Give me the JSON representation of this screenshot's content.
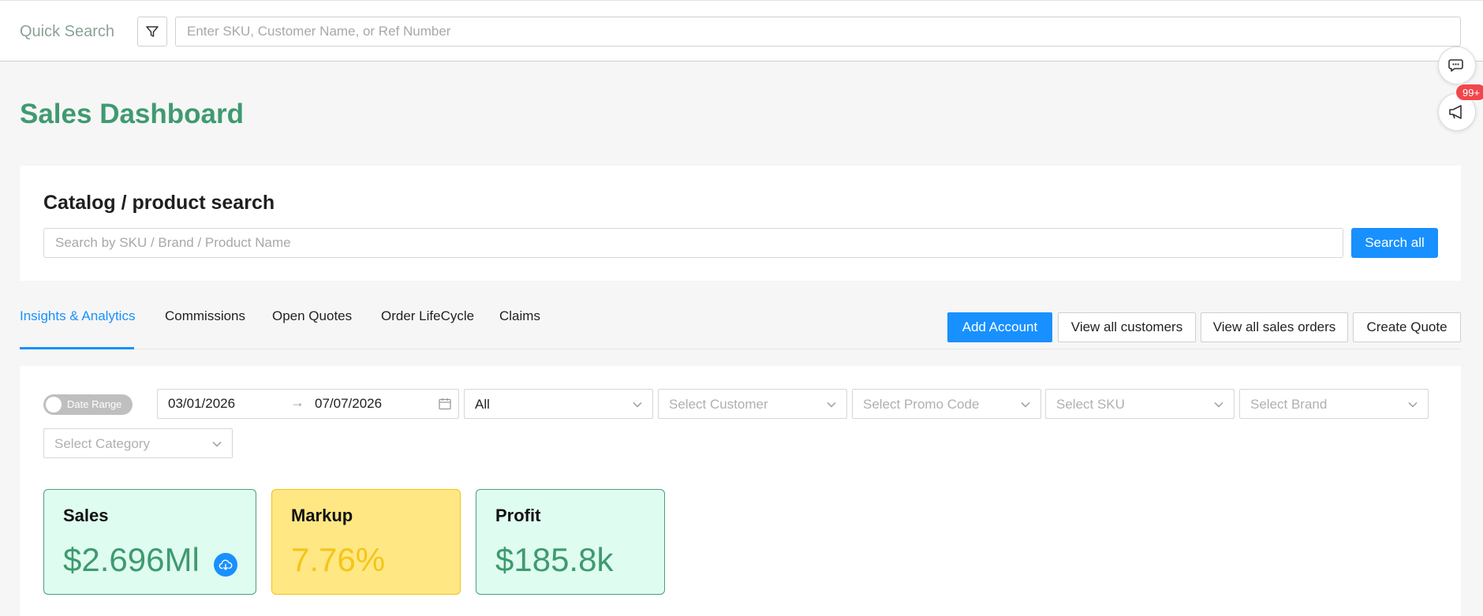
{
  "quick_search": {
    "label": "Quick Search",
    "placeholder": "Enter SKU, Customer Name, or Ref Number",
    "value": ""
  },
  "floating": {
    "chat_icon": "chat-bubbles-icon",
    "notify_icon": "megaphone-icon",
    "notify_badge": "99+"
  },
  "page_title": "Sales Dashboard",
  "catalog": {
    "title": "Catalog / product search",
    "placeholder": "Search by SKU / Brand / Product Name",
    "search_all_label": "Search all"
  },
  "tabs": [
    {
      "label": "Insights & Analytics",
      "active": true
    },
    {
      "label": "Commissions",
      "active": false
    },
    {
      "label": "Open Quotes",
      "active": false
    },
    {
      "label": "Order LifeCycle",
      "active": false
    },
    {
      "label": "Claims",
      "active": false
    }
  ],
  "actions": {
    "add_account": "Add Account",
    "view_customers": "View all customers",
    "view_orders": "View all sales orders",
    "create_quote": "Create Quote"
  },
  "filters": {
    "date_range_toggle": "Date Range",
    "date_start": "03/01/2026",
    "date_end": "07/07/2026",
    "status_value": "All",
    "customer_placeholder": "Select Customer",
    "promo_placeholder": "Select Promo Code",
    "sku_placeholder": "Select SKU",
    "brand_placeholder": "Select Brand",
    "category_placeholder": "Select Category"
  },
  "kpis": {
    "sales": {
      "title": "Sales",
      "value": "$2.696Ml"
    },
    "markup": {
      "title": "Markup",
      "value": "7.76%"
    },
    "profit": {
      "title": "Profit",
      "value": "$185.8k"
    }
  },
  "colors": {
    "accent": "#1890ff",
    "brand_green": "#3f9a70",
    "markup_yellow": "#f5c518",
    "badge_red": "#f0474c"
  }
}
